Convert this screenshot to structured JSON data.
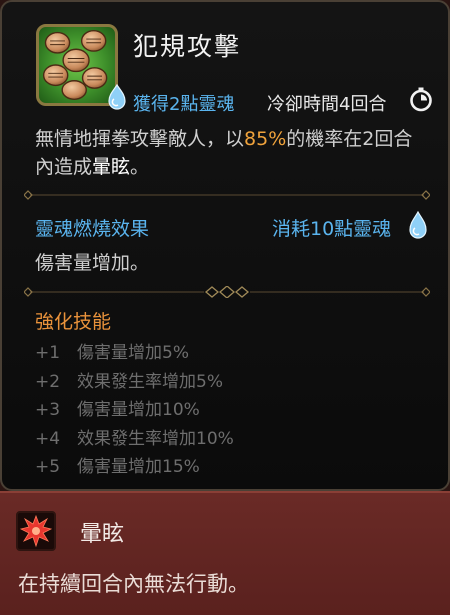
{
  "skill": {
    "name": "犯規攻擊",
    "icon": "fists-icon",
    "gain_soul": "獲得2點靈魂",
    "cooldown": "冷卻時間4回合",
    "description": {
      "part1": "無情地揮拳攻擊敵人，以",
      "percent": "85%",
      "part2": "的機率在2回合內造成",
      "keyword": "暈眩",
      "part3": "。"
    }
  },
  "soul_burn": {
    "title": "靈魂燃燒效果",
    "cost": "消耗10點靈魂",
    "effect": "傷害量增加。"
  },
  "enhance": {
    "title": "強化技能",
    "items": [
      {
        "level": "+1",
        "text": "傷害量增加5%"
      },
      {
        "level": "+2",
        "text": "效果發生率增加5%"
      },
      {
        "level": "+3",
        "text": "傷害量增加10%"
      },
      {
        "level": "+4",
        "text": "效果發生率增加10%"
      },
      {
        "level": "+5",
        "text": "傷害量增加15%"
      }
    ]
  },
  "status_effect": {
    "name": "暈眩",
    "icon": "stun-burst-icon",
    "description": "在持續回合內無法行動。"
  },
  "colors": {
    "soul_blue": "#5ab4ee",
    "highlight_orange": "#f0a33c",
    "enhance_orange": "#e9923b",
    "status_bg": "#6a2a26"
  }
}
